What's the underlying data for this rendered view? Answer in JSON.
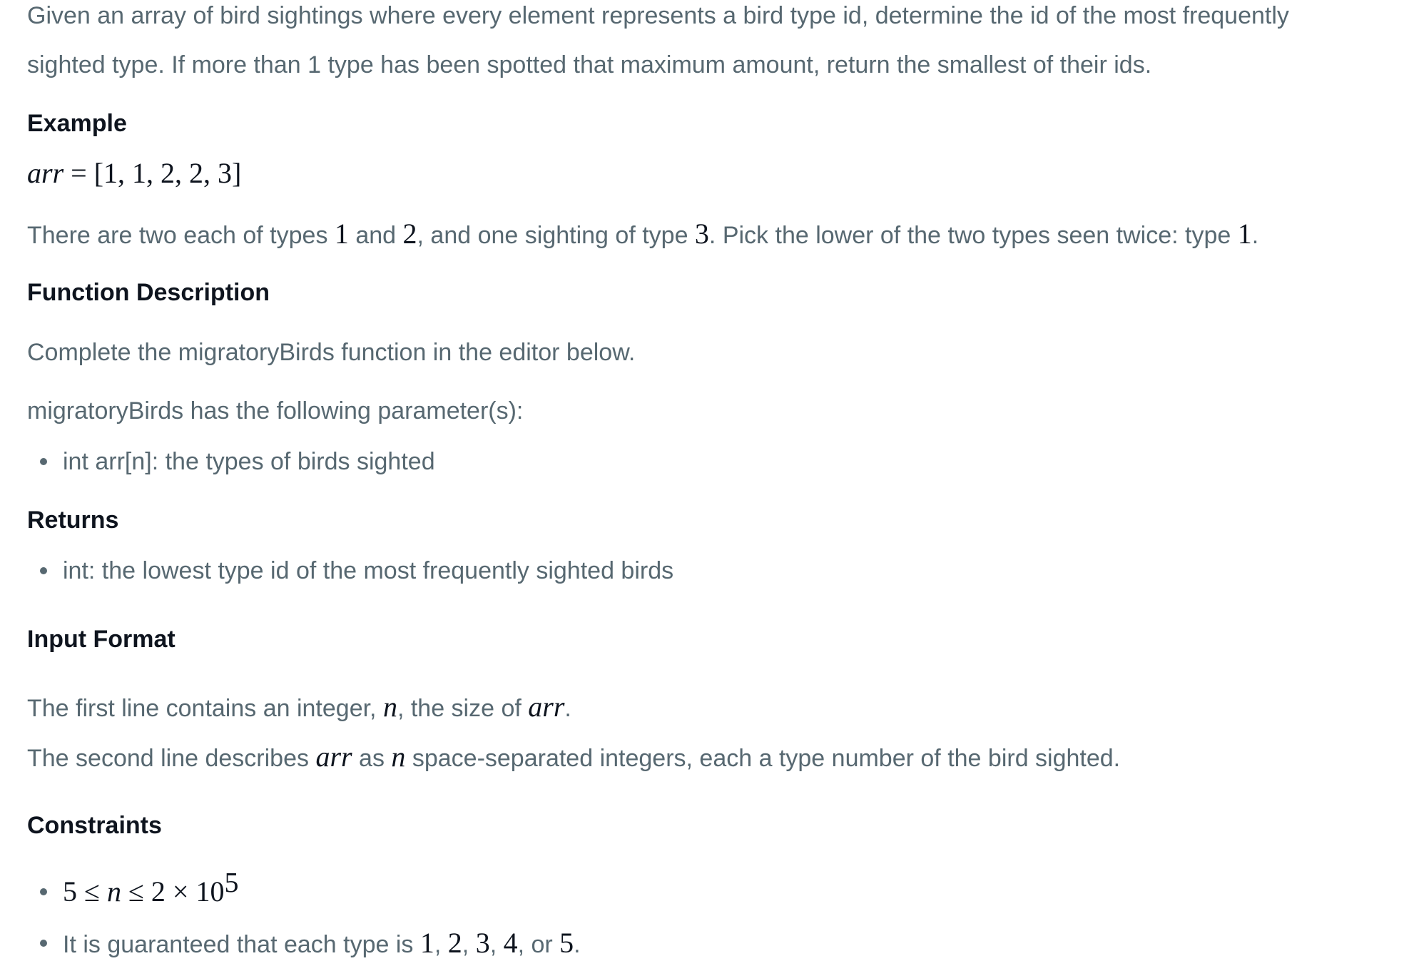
{
  "intro": {
    "line1": "Given an array of bird sightings where every element represents a bird type id, determine the id of the most frequently",
    "line2": "sighted type. If more than 1 type has been spotted that maximum amount, return the smallest of their ids."
  },
  "example": {
    "heading": "Example",
    "eq_var": "arr",
    "eq_rest": " = [1, 1, 2, 2, 3]",
    "explanation": [
      "There are two each of types ",
      "1",
      " and ",
      "2",
      ", and one sighting of type ",
      "3",
      ". Pick the lower of the two types seen twice: type ",
      "1",
      "."
    ]
  },
  "function_description": {
    "heading": "Function Description",
    "text": "Complete the migratoryBirds function in the editor below.",
    "params_intro": "migratoryBirds has the following parameter(s):",
    "params": [
      "int arr[n]: the types of birds sighted"
    ]
  },
  "returns": {
    "heading": "Returns",
    "items": [
      "int: the lowest type id of the most frequently sighted birds"
    ]
  },
  "input_format": {
    "heading": "Input Format",
    "line1": [
      "The first line contains an integer, ",
      "n",
      ", the size of ",
      "arr",
      "."
    ],
    "line2": [
      "The second line describes ",
      "arr",
      " as ",
      "n",
      " space-separated integers, each a type number of the bird sighted."
    ]
  },
  "constraints": {
    "heading": "Constraints",
    "c1": [
      "5 ≤ ",
      "n",
      " ≤ 2 × 10",
      "5"
    ],
    "c2": [
      "It is guaranteed that each type is ",
      "1",
      ", ",
      "2",
      ", ",
      "3",
      ", ",
      "4",
      ", or ",
      "5",
      "."
    ]
  }
}
